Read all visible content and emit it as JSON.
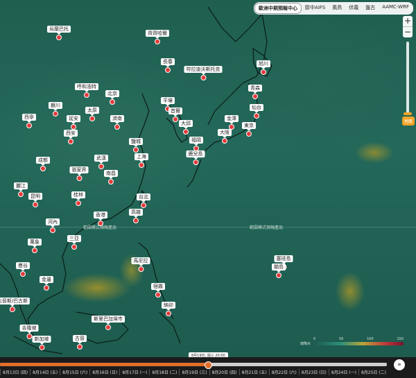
{
  "model_tabs": [
    {
      "label": "歐洲中期預報中心",
      "active": true
    },
    {
      "label": "歐中AIFS",
      "active": false
    },
    {
      "label": "風鳥",
      "active": false
    },
    {
      "label": "伏羲",
      "active": false
    },
    {
      "label": "盤古",
      "active": false
    },
    {
      "label": "AAMC-WRF",
      "active": false
    }
  ],
  "zoom": {
    "in": "+",
    "out": "−"
  },
  "altitude": {
    "label": "地面"
  },
  "band_labels": [
    "範圍模式預報產品",
    "範圍模式預報產品"
  ],
  "legend": {
    "label": "總降水",
    "ticks": [
      "0",
      "50",
      "100",
      "150"
    ]
  },
  "timeline": {
    "current": "8月19日, 週三 20:00",
    "progress": 0.535,
    "days": [
      "8月13日 (四)",
      "8月14日 (五)",
      "8月15日 (六)",
      "8月16日 (日)",
      "8月17日 (一)",
      "8月18日 (二)",
      "8月19日 (三)",
      "8月20日 (四)",
      "8月21日 (五)",
      "8月22日 (六)",
      "8月23日 (日)",
      "8月24日 (一)",
      "8月25日 (二)"
    ],
    "play": "»"
  },
  "cities": [
    {
      "name": "烏蘭巴托"
    },
    {
      "name": "齊齊哈爾"
    },
    {
      "name": "長春"
    },
    {
      "name": "符拉迪沃斯托克"
    },
    {
      "name": "旭川"
    },
    {
      "name": "呼和浩特"
    },
    {
      "name": "北京"
    },
    {
      "name": "青森"
    },
    {
      "name": "銀川"
    },
    {
      "name": "平壤"
    },
    {
      "name": "太原"
    },
    {
      "name": "首爾"
    },
    {
      "name": "仙台"
    },
    {
      "name": "西寧"
    },
    {
      "name": "延安"
    },
    {
      "name": "濟南"
    },
    {
      "name": "大邱"
    },
    {
      "name": "金澤"
    },
    {
      "name": "東京"
    },
    {
      "name": "西安"
    },
    {
      "name": "大阪"
    },
    {
      "name": "福岡"
    },
    {
      "name": "鹽城"
    },
    {
      "name": "鹿兒島"
    },
    {
      "name": "成都"
    },
    {
      "name": "武漢"
    },
    {
      "name": "上海"
    },
    {
      "name": "張家界"
    },
    {
      "name": "南昌"
    },
    {
      "name": "麗江"
    },
    {
      "name": "昆明"
    },
    {
      "name": "桂林"
    },
    {
      "name": "台北"
    },
    {
      "name": "香港"
    },
    {
      "name": "高雄"
    },
    {
      "name": "河內"
    },
    {
      "name": "萬象"
    },
    {
      "name": "三亞"
    },
    {
      "name": "馬尼拉"
    },
    {
      "name": "塞班島"
    },
    {
      "name": "曼谷"
    },
    {
      "name": "關島"
    },
    {
      "name": "金邊"
    },
    {
      "name": "宿霧"
    },
    {
      "name": "古晉斯/巴古斯"
    },
    {
      "name": "納卯"
    },
    {
      "name": "吉隆坡"
    },
    {
      "name": "斯里巴加灣市"
    },
    {
      "name": "新加坡"
    },
    {
      "name": "古晉"
    }
  ],
  "colors": {
    "map": "#1e5a4e",
    "marker": "#e43a3a",
    "accent": "#e06f2a",
    "altitude": "#f1a529"
  }
}
